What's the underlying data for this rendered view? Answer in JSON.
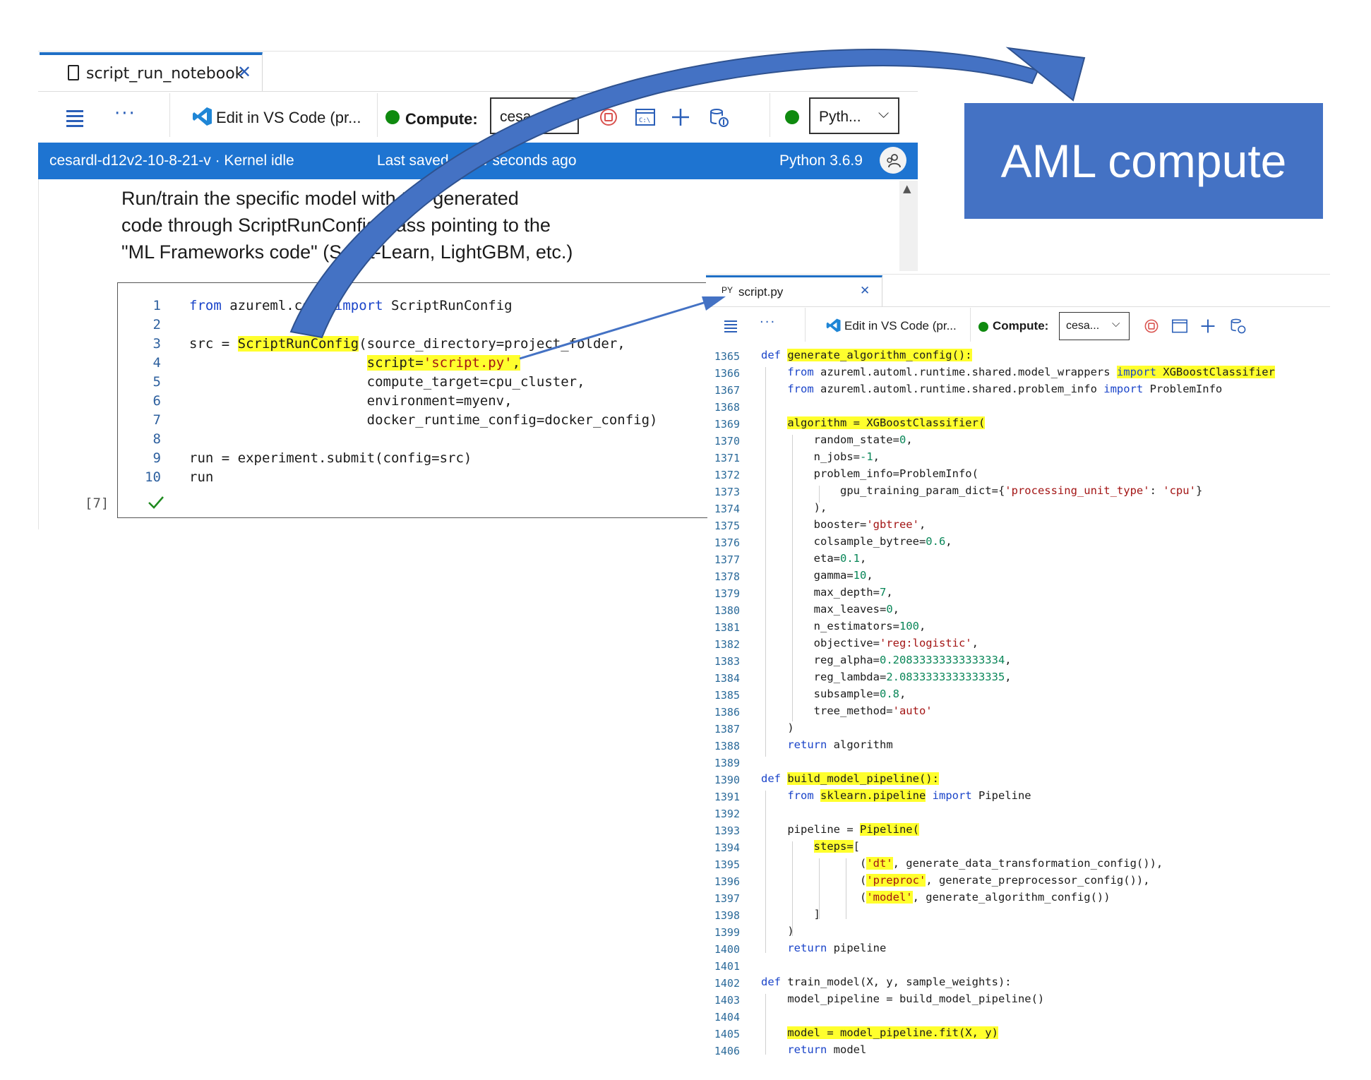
{
  "notebook": {
    "tab_label": "script_run_notebook",
    "toolbar": {
      "edit_label": "Edit in VS Code (pr...",
      "compute_label": "Compute:",
      "compute_value": "cesa...",
      "kernel_value": "Pyth..."
    },
    "status": {
      "machine": "cesardl-d12v2-10-8-21-v · Kernel idle",
      "saved": "Last saved a few seconds ago",
      "python_version": "Python 3.6.9"
    },
    "markdown_lines": [
      "Run/train the specific model with the generated",
      "code through ScriptRunConfig class pointing to the",
      "\"ML Frameworks code\" (Scikit-Learn, LightGBM, etc.)"
    ],
    "cell": {
      "execution_count": "[7]",
      "line_numbers": [
        "1",
        "2",
        "3",
        "4",
        "5",
        "6",
        "7",
        "8",
        "9",
        "10"
      ]
    }
  },
  "aml_label": "AML compute",
  "script": {
    "tab_label": "script.py",
    "tab_icon_text": "PY",
    "toolbar": {
      "edit_label": "Edit in VS Code (pr...",
      "compute_label": "Compute:",
      "compute_value": "cesa..."
    },
    "line_numbers": [
      "1365",
      "1366",
      "1367",
      "1368",
      "1369",
      "1370",
      "1371",
      "1372",
      "1373",
      "1374",
      "1375",
      "1376",
      "1377",
      "1378",
      "1379",
      "1380",
      "1381",
      "1382",
      "1383",
      "1384",
      "1385",
      "1386",
      "1387",
      "1388",
      "1389",
      "1390",
      "1391",
      "1392",
      "1393",
      "1394",
      "1395",
      "1396",
      "1397",
      "1398",
      "1399",
      "1400",
      "1401",
      "1402",
      "1403",
      "1404",
      "1405",
      "1406"
    ]
  },
  "colors": {
    "accent_blue": "#1e74d1",
    "aml_box": "#4472c4",
    "arrow_blue": "#4472c4",
    "highlight_yellow": "#ffff2d",
    "status_green": "#0f8a0f",
    "stop_red": "#d9534f"
  },
  "icons": [
    "document-icon",
    "close-icon",
    "menu-icon",
    "more-icon",
    "vscode-icon",
    "stop-icon",
    "terminal-icon",
    "plus-icon",
    "compute-instance-icon",
    "chevron-down-icon",
    "user-icon",
    "scroll-up-icon",
    "checkmark-icon"
  ]
}
